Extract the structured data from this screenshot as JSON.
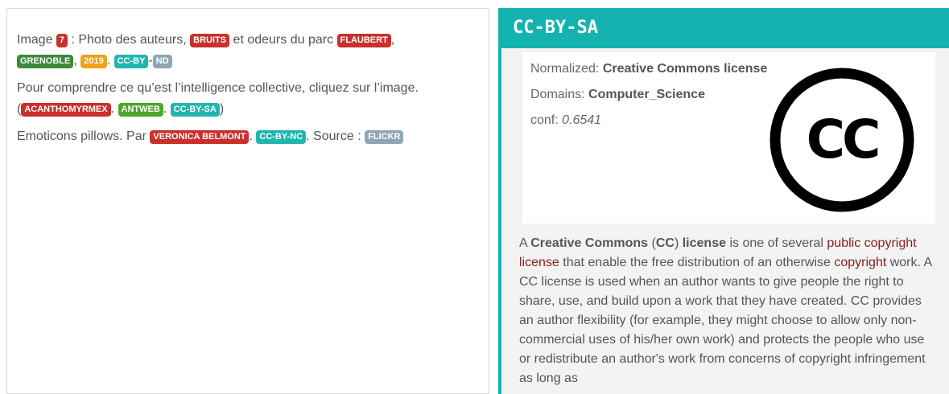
{
  "left": {
    "p1": {
      "t1": "Image ",
      "badge_7": "7",
      "t2": " : Photo des auteurs, ",
      "badge_bruits": "BRUITS",
      "t3": " et odeurs du parc ",
      "badge_flaubert": "FLAUBERT",
      "t4": ",",
      "badge_grenoble": "GRENOBLE",
      "t5": ", ",
      "badge_2019": "2019",
      "t6": ". ",
      "badge_ccby": "CC-BY",
      "t7": "-",
      "badge_nd": "ND"
    },
    "p2": {
      "t1": "Pour comprendre ce qu’est l’intelligence collective, cliquez sur l’image.",
      "t2": "(",
      "badge_acanthomyrmex": "ACANTHOMYRMEX",
      "t3": ". ",
      "badge_antweb": "ANTWEB",
      "t4": ". ",
      "badge_ccbysa": "CC-BY-SA",
      "t5": ")"
    },
    "p3": {
      "t1": "Emoticons pillows. Par ",
      "badge_veronica": "VERONICA BELMONT",
      "t2": ". ",
      "badge_ccbync": "CC-BY-NC",
      "t3": ". Source : ",
      "badge_flickr": "FLICKR"
    }
  },
  "right": {
    "title": "CC-BY-SA",
    "normalized_label": "Normalized: ",
    "normalized_value": "Creative Commons license",
    "domains_label": "Domains: ",
    "domains_value": "Computer_Science",
    "conf_label": "conf: ",
    "conf_value": "0.6541",
    "logo_icon": "creative-commons-cc-icon",
    "logo_text": "CC",
    "description": {
      "d1": "A ",
      "d2": "Creative Commons",
      "d3": " (",
      "d4": "CC",
      "d5": ") ",
      "d6": "license",
      "d7": " is one of several ",
      "link1": "public copyright license",
      "d8": " that enable the free distribution of an otherwise ",
      "link2": "copyright",
      "d9": " work. A CC license is used when an author wants to give people the right to share, use, and build upon a work that they have created. CC provides an author flexibility (for example, they might choose to allow only non-commercial uses of his/her own work) and protects the people who use or redistribute an author's work from concerns of copyright infringement as long as"
    }
  },
  "colors": {
    "teal": "#14b3b0",
    "badge_red": "#c9302c",
    "badge_green": "#3c8a3a",
    "badge_light_green": "#4fa62d",
    "badge_orange": "#f0a01a",
    "badge_teal": "#22b5b0",
    "badge_grey": "#8fa6b4",
    "link": "#8b1d1d"
  }
}
